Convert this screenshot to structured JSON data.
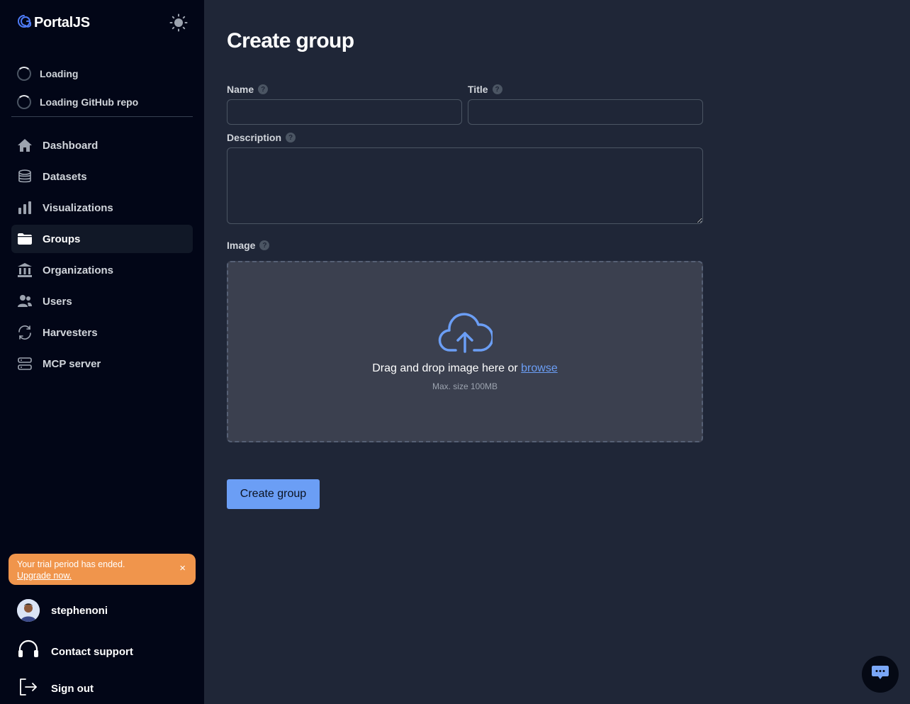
{
  "brand": {
    "name": "PortalJS"
  },
  "sidebar": {
    "loading": [
      {
        "label": "Loading"
      },
      {
        "label": "Loading GitHub repo"
      }
    ],
    "nav": [
      {
        "label": "Dashboard",
        "icon": "home-icon"
      },
      {
        "label": "Datasets",
        "icon": "database-icon"
      },
      {
        "label": "Visualizations",
        "icon": "bar-chart-icon"
      },
      {
        "label": "Groups",
        "icon": "folder-icon",
        "active": true
      },
      {
        "label": "Organizations",
        "icon": "building-icon"
      },
      {
        "label": "Users",
        "icon": "users-icon"
      },
      {
        "label": "Harvesters",
        "icon": "refresh-icon"
      },
      {
        "label": "MCP server",
        "icon": "server-icon"
      }
    ],
    "trial": {
      "message": "Your trial period has ended.",
      "link": "Upgrade now.",
      "close": "×"
    },
    "user": {
      "name": "stephenoni"
    },
    "support": {
      "label": "Contact support"
    },
    "signout": {
      "label": "Sign out"
    }
  },
  "page": {
    "title": "Create group",
    "fields": {
      "name": {
        "label": "Name",
        "value": ""
      },
      "title": {
        "label": "Title",
        "value": ""
      },
      "description": {
        "label": "Description",
        "value": ""
      },
      "image": {
        "label": "Image"
      }
    },
    "help_glyph": "?",
    "dropzone": {
      "text": "Drag and drop image here or",
      "browse": "browse",
      "hint": "Max. size 100MB"
    },
    "submit": "Create group"
  },
  "colors": {
    "accent": "#6b9ef5",
    "sidebar_bg": "#020617",
    "main_bg": "#1f2637",
    "trial_bg": "#f0954c"
  }
}
